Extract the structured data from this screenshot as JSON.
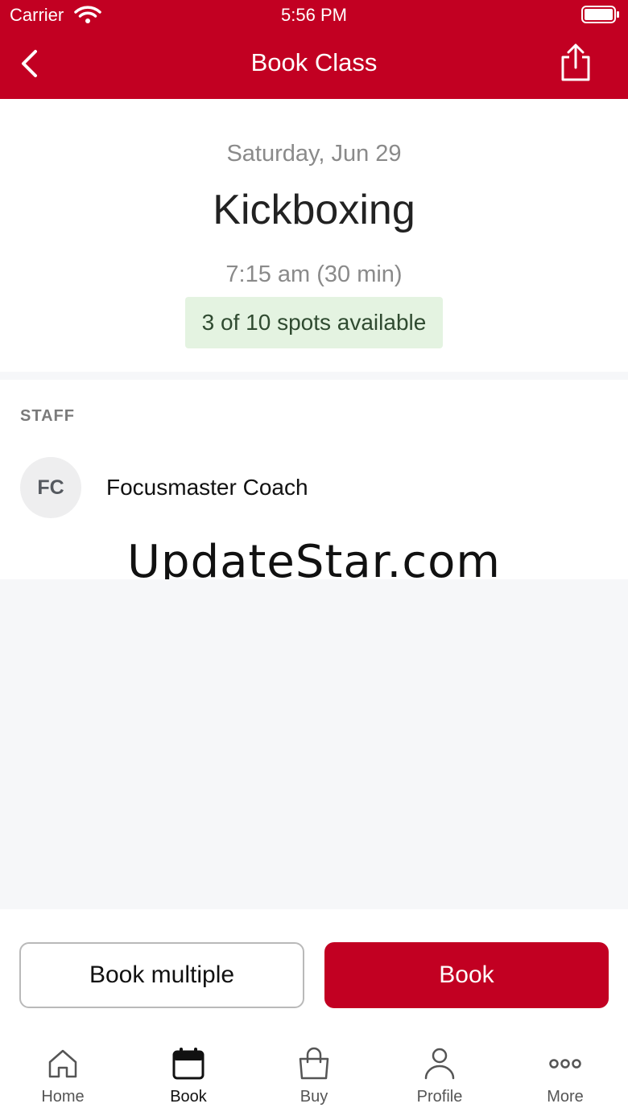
{
  "status_bar": {
    "carrier": "Carrier",
    "time": "5:56 PM"
  },
  "header": {
    "title": "Book Class",
    "back_icon": "chevron-left-icon",
    "share_icon": "share-icon",
    "background_color": "#c20022"
  },
  "class_info": {
    "date": "Saturday, Jun 29",
    "name": "Kickboxing",
    "time": "7:15 am (30 min)",
    "spots": "3 of 10 spots available"
  },
  "staff": {
    "heading": "STAFF",
    "members": [
      {
        "initials": "FC",
        "name": "Focusmaster Coach"
      }
    ]
  },
  "watermark": "UpdateStar.com",
  "actions": {
    "book_multiple": "Book multiple",
    "book": "Book"
  },
  "tabbar": {
    "tabs": [
      {
        "label": "Home",
        "icon": "home-icon"
      },
      {
        "label": "Book",
        "icon": "calendar-icon",
        "active": true
      },
      {
        "label": "Buy",
        "icon": "shopping-bag-icon"
      },
      {
        "label": "Profile",
        "icon": "person-icon"
      },
      {
        "label": "More",
        "icon": "more-icon"
      }
    ]
  }
}
